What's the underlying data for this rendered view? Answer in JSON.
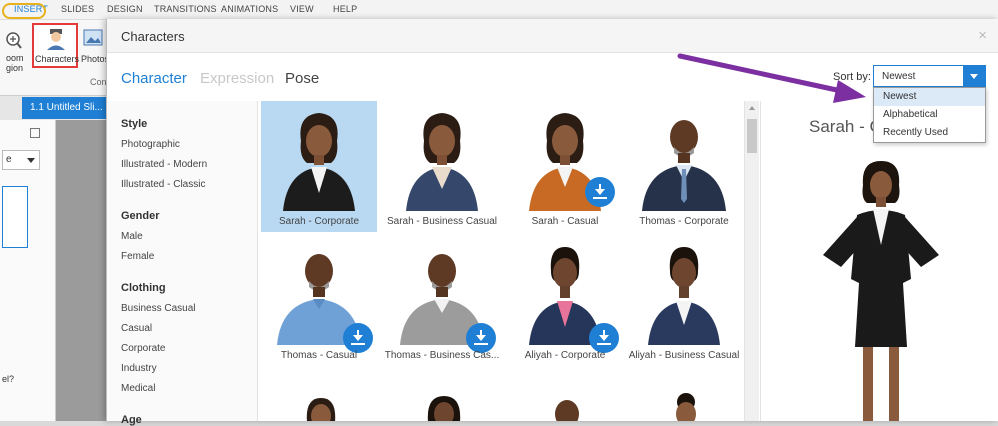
{
  "ribbon": {
    "tabs": [
      "INSERT",
      "SLIDES",
      "DESIGN",
      "TRANSITIONS",
      "ANIMATIONS",
      "VIEW",
      "HELP"
    ],
    "zoom_label_1": "oom",
    "zoom_label_2": "gion",
    "characters_label": "Characters",
    "photos_label": "Photos",
    "group_label": "Con"
  },
  "app": {
    "slide_tab": "1.1 Untitled Sli...",
    "left_dropdown": "e",
    "left_question": "el?"
  },
  "dialog": {
    "title": "Characters",
    "close": "×",
    "tabs": [
      "Character",
      "Expression",
      "Pose"
    ],
    "sort_label": "Sort by:",
    "sort_value": "Newest",
    "sort_options": [
      "Newest",
      "Alphabetical",
      "Recently Used"
    ]
  },
  "filters": {
    "style": {
      "heading": "Style",
      "items": [
        "Photographic",
        "Illustrated - Modern",
        "Illustrated - Classic"
      ]
    },
    "gender": {
      "heading": "Gender",
      "items": [
        "Male",
        "Female"
      ]
    },
    "clothing": {
      "heading": "Clothing",
      "items": [
        "Business Casual",
        "Casual",
        "Corporate",
        "Industry",
        "Medical"
      ]
    },
    "age": {
      "heading": "Age"
    }
  },
  "characters": [
    {
      "name": "Sarah - Corporate",
      "selected": true
    },
    {
      "name": "Sarah - Business Casual"
    },
    {
      "name": "Sarah - Casual"
    },
    {
      "name": "Thomas - Corporate"
    },
    {
      "name": "Thomas - Casual"
    },
    {
      "name": "Thomas - Business Cas..."
    },
    {
      "name": "Aliyah - Corporate"
    },
    {
      "name": "Aliyah - Business Casual"
    }
  ],
  "preview": {
    "title": "Sarah - C"
  },
  "colors": {
    "accent": "#1e7fd4",
    "selected": "#b9d9f2",
    "highlight_ring": "#e8b21c",
    "arrow": "#7b2fa0"
  }
}
